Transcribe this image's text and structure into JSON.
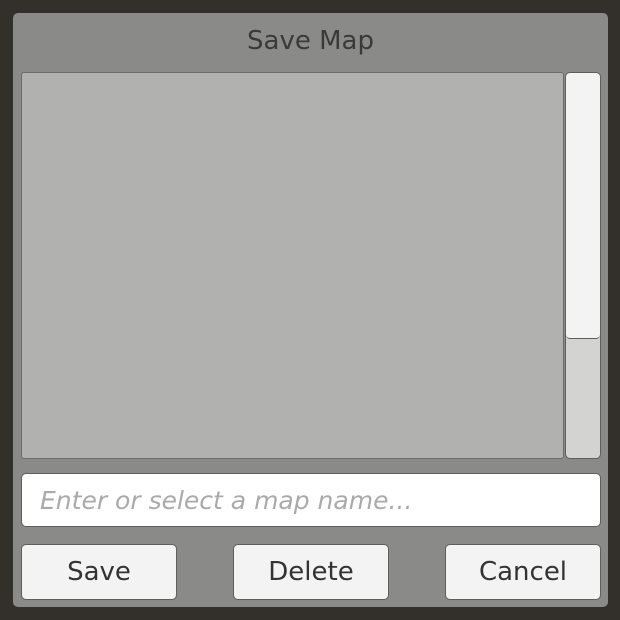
{
  "dialog": {
    "title": "Save Map",
    "input": {
      "value": "",
      "placeholder": "Enter or select a map name..."
    },
    "buttons": {
      "save_label": "Save",
      "delete_label": "Delete",
      "cancel_label": "Cancel"
    },
    "scrollbar": {
      "thumb_fraction": 0.69
    },
    "colors": {
      "background": "#332f2b",
      "panel": "#8a8a88",
      "list": "#b1b1af",
      "button": "#f3f3f3"
    }
  }
}
